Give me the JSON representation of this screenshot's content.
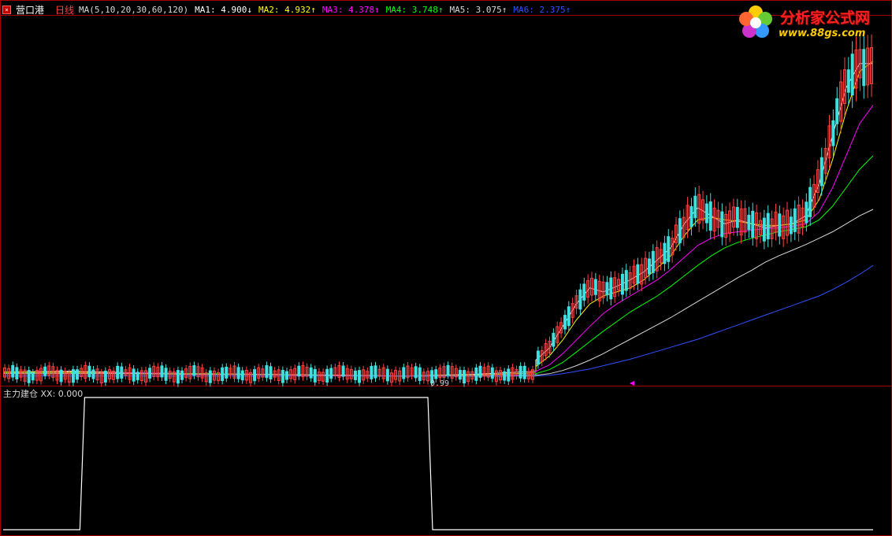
{
  "header": {
    "stock_name": "营口港",
    "period": "日线",
    "ma_params": "MA(5,10,20,30,60,120)",
    "ma_items": [
      {
        "text": "MA1: 4.900↓",
        "color": "#ffffff"
      },
      {
        "text": "MA2: 4.932↑",
        "color": "#ffff00"
      },
      {
        "text": "MA3: 4.378↑",
        "color": "#ff00ff"
      },
      {
        "text": "MA4: 3.748↑",
        "color": "#00ff00"
      },
      {
        "text": "MA5: 3.075↑",
        "color": "#d8d8d8"
      },
      {
        "text": "MA6: 2.375↑",
        "color": "#3050ff"
      }
    ]
  },
  "indicator": {
    "header": "主力建仓 XX: 0.000"
  },
  "price_chart": {
    "low_label": "0.99"
  },
  "logo": {
    "title": "分析家公式网",
    "url": "www.88gs.com"
  },
  "colors": {
    "background": "#000000",
    "border": "#a00000",
    "up_candle": "#ff4040",
    "down_candle": "#40e0e0",
    "indicator_line": "#ffffff"
  },
  "chart_data": {
    "type": "line",
    "price_series": [
      {
        "name": "MA1",
        "values": [
          1.05,
          1.06,
          1.04,
          1.03,
          1.02,
          1.01,
          1.0,
          1.02,
          1.06,
          1.2,
          1.35,
          1.62,
          1.9,
          2.1,
          2.05,
          2.12,
          2.2,
          2.3,
          2.45,
          2.6,
          2.9,
          3.1,
          3.0,
          2.9,
          2.95,
          2.9,
          2.85,
          2.88,
          2.9,
          3.0,
          3.4,
          4.0,
          4.6,
          4.9,
          4.9
        ]
      },
      {
        "name": "MA2",
        "values": [
          1.05,
          1.05,
          1.04,
          1.03,
          1.02,
          1.01,
          1.0,
          1.01,
          1.04,
          1.12,
          1.25,
          1.45,
          1.7,
          1.9,
          2.0,
          2.05,
          2.1,
          2.2,
          2.35,
          2.5,
          2.75,
          2.95,
          2.98,
          2.95,
          2.93,
          2.9,
          2.88,
          2.88,
          2.9,
          2.95,
          3.2,
          3.7,
          4.3,
          4.8,
          4.93
        ]
      },
      {
        "name": "MA3",
        "values": [
          1.04,
          1.04,
          1.04,
          1.03,
          1.02,
          1.01,
          1.0,
          1.0,
          1.02,
          1.06,
          1.14,
          1.28,
          1.45,
          1.62,
          1.78,
          1.9,
          2.0,
          2.1,
          2.2,
          2.33,
          2.48,
          2.63,
          2.72,
          2.78,
          2.8,
          2.82,
          2.84,
          2.85,
          2.87,
          2.9,
          3.05,
          3.35,
          3.75,
          4.15,
          4.38
        ]
      },
      {
        "name": "MA4",
        "values": [
          1.04,
          1.04,
          1.03,
          1.03,
          1.02,
          1.01,
          1.0,
          1.0,
          1.01,
          1.03,
          1.08,
          1.17,
          1.3,
          1.43,
          1.56,
          1.68,
          1.8,
          1.9,
          2.0,
          2.12,
          2.25,
          2.38,
          2.5,
          2.6,
          2.67,
          2.72,
          2.76,
          2.8,
          2.83,
          2.86,
          2.95,
          3.12,
          3.35,
          3.58,
          3.75
        ]
      },
      {
        "name": "MA5",
        "values": [
          1.03,
          1.03,
          1.03,
          1.02,
          1.02,
          1.01,
          1.0,
          1.0,
          1.0,
          1.01,
          1.03,
          1.07,
          1.13,
          1.2,
          1.28,
          1.37,
          1.46,
          1.55,
          1.64,
          1.73,
          1.83,
          1.93,
          2.03,
          2.13,
          2.23,
          2.32,
          2.42,
          2.5,
          2.57,
          2.64,
          2.72,
          2.8,
          2.9,
          3.0,
          3.08
        ]
      },
      {
        "name": "MA6",
        "values": [
          1.0,
          1.0,
          1.0,
          1.0,
          1.0,
          1.0,
          1.0,
          1.0,
          1.0,
          1.0,
          1.01,
          1.03,
          1.06,
          1.09,
          1.13,
          1.17,
          1.21,
          1.26,
          1.31,
          1.36,
          1.41,
          1.46,
          1.52,
          1.58,
          1.64,
          1.7,
          1.76,
          1.82,
          1.88,
          1.94,
          2.0,
          2.08,
          2.17,
          2.27,
          2.38
        ]
      }
    ],
    "indicator_series": {
      "name": "XX",
      "values": [
        0,
        0,
        0,
        0,
        0,
        1,
        1,
        1,
        1,
        1,
        1,
        1,
        1,
        1,
        1,
        1,
        1,
        1,
        1,
        1,
        1,
        1,
        1,
        1,
        1,
        1,
        1,
        0,
        0,
        0,
        0,
        0,
        0,
        0,
        0,
        0,
        0,
        0,
        0,
        0,
        0,
        0,
        0,
        0,
        0,
        0,
        0,
        0,
        0,
        0,
        0,
        0,
        0,
        0,
        0,
        0
      ]
    }
  }
}
